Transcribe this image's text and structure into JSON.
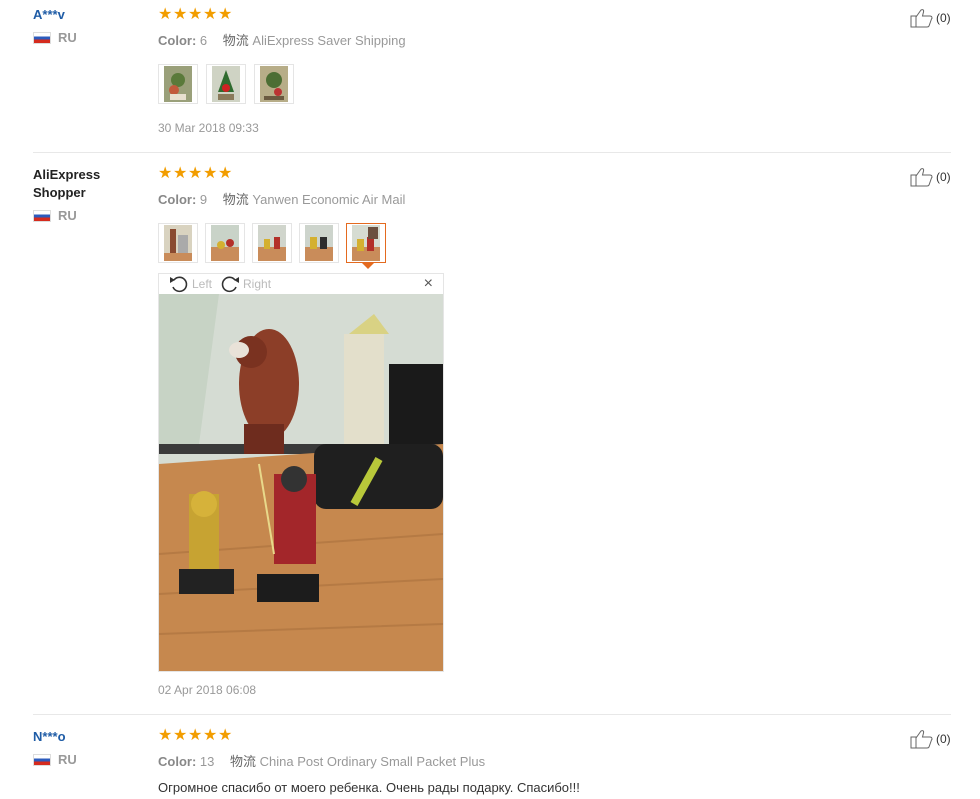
{
  "reviews": [
    {
      "name": "A***v",
      "country": "RU",
      "stars": 5,
      "color_label": "Color:",
      "color_value": "6",
      "shipping_label": "物流",
      "shipping_value": "AliExpress Saver Shipping",
      "date": "30 Mar 2018 09:33",
      "likes": "(0)"
    },
    {
      "name": "AliExpress Shopper",
      "country": "RU",
      "stars": 5,
      "color_label": "Color:",
      "color_value": "9",
      "shipping_label": "物流",
      "shipping_value": "Yanwen Economic Air Mail",
      "date": "02 Apr 2018 06:08",
      "likes": "(0)",
      "viewer": {
        "rotate_left": "Left",
        "rotate_right": "Right",
        "close": "×"
      }
    },
    {
      "name": "N***o",
      "country": "RU",
      "stars": 5,
      "color_label": "Color:",
      "color_value": "13",
      "shipping_label": "物流",
      "shipping_value": "China Post Ordinary Small Packet Plus",
      "comment": "Огромное спасибо от моего ребенка. Очень рады подарку. Спасибо!!!",
      "likes": "(0)"
    }
  ],
  "colors": {
    "star": "#f29d00",
    "link": "#1f5ca6",
    "active_thumb": "#e46a1f"
  }
}
